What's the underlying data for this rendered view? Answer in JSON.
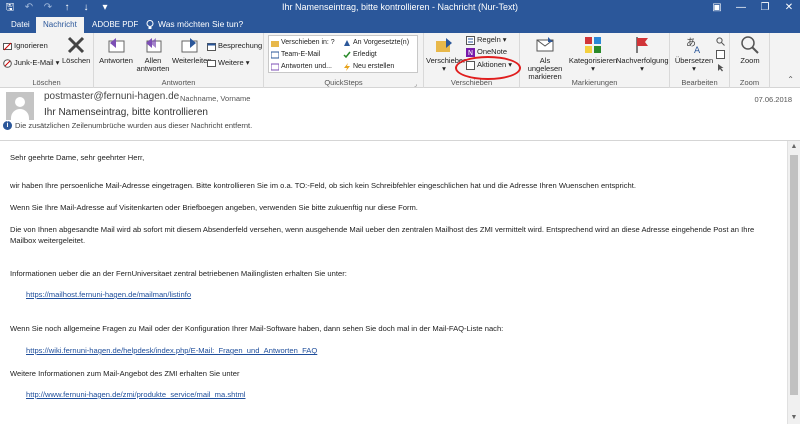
{
  "window": {
    "title": "Ihr Namenseintrag, bitte kontrollieren - Nachricht (Nur-Text)"
  },
  "tabs": [
    {
      "label": "Datei"
    },
    {
      "label": "Nachricht"
    },
    {
      "label": "ADOBE PDF"
    }
  ],
  "tellme": "Was möchten Sie tun?",
  "ribbon": {
    "loeschen": {
      "label": "Löschen",
      "ignorieren": "Ignorieren",
      "junk": "Junk-E-Mail",
      "loeschen_btn": "Löschen"
    },
    "antworten": {
      "label": "Antworten",
      "antworten_btn": "Antworten",
      "allen_line1": "Allen",
      "allen_line2": "antworten",
      "weiterleiten": "Weiterleiten",
      "besprechung": "Besprechung",
      "weitere": "Weitere"
    },
    "quicksteps": {
      "label": "QuickSteps",
      "items": [
        "Verschieben in: ?",
        "Team-E-Mail",
        "Antworten und...",
        "An Vorgesetzte(n)",
        "Erledigt",
        "Neu erstellen"
      ]
    },
    "verschieben": {
      "label": "Verschieben",
      "verschieben_btn": "Verschieben",
      "regeln": "Regeln",
      "onenote": "OneNote",
      "aktionen": "Aktionen"
    },
    "markierungen": {
      "label": "Markierungen",
      "ungelesen_line1": "Als ungelesen",
      "ungelesen_line2": "markieren",
      "kategorisieren": "Kategorisieren",
      "nachverfolgung": "Nachverfolgung"
    },
    "bearbeiten": {
      "label": "Bearbeiten",
      "uebersetzen": "Übersetzen"
    },
    "zoom": {
      "label": "Zoom",
      "zoom_btn": "Zoom"
    }
  },
  "message": {
    "sender": "postmaster@fernuni-hagen.de",
    "sender_name": "Nachname, Vorname",
    "date": "07.06.2018",
    "subject": "Ihr Namenseintrag, bitte kontrollieren",
    "info": "Die zusätzlichen Zeilenumbrüche wurden aus dieser Nachricht entfernt."
  },
  "body": {
    "p1": "Sehr geehrte Dame, sehr geehrter Herr,",
    "p2": "wir haben Ihre persoenliche Mail-Adresse eingetragen. Bitte kontrollieren Sie im o.a. TO:-Feld, ob sich kein Schreibfehler eingeschlichen hat und die Adresse Ihren Wuenschen entspricht.",
    "p3": "Wenn Sie Ihre Mail-Adresse auf Visitenkarten oder Briefboegen angeben, verwenden Sie bitte zukuenftig nur diese Form.",
    "p4": "Die von Ihnen abgesandte Mail wird ab sofort mit diesem Absenderfeld versehen, wenn ausgehende Mail ueber den zentralen Mailhost des ZMI vermittelt wird. Entsprechend wird an diese Adresse eingehende Post an Ihre Mailbox weitergeleitet.",
    "p5": "Informationen ueber die an der FernUniversitaet zentral betriebenen Mailinglisten erhalten Sie unter:",
    "link1": "https://mailhost.fernuni-hagen.de/mailman/listinfo",
    "p6": "Wenn Sie noch allgemeine Fragen zu Mail oder der Konfiguration Ihrer Mail-Software haben, dann sehen Sie doch mal in der Mail-FAQ-Liste nach:",
    "link2": "https://wiki.fernuni-hagen.de/helpdesk/index.php/E-Mail:_Fragen_und_Antworten_FAQ",
    "p7": "Weitere Informationen zum Mail-Angebot des ZMI erhalten Sie unter",
    "link3": "http://www.fernuni-hagen.de/zmi/produkte_service/mail_ma.shtml"
  },
  "colors": {
    "accent": "#2b579a",
    "annotation": "#e01d1d"
  }
}
